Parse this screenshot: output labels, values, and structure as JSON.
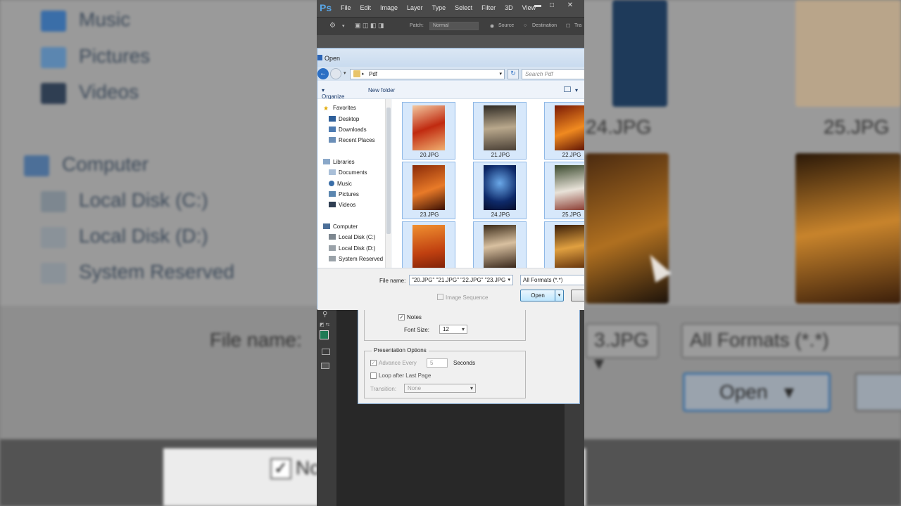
{
  "background": {
    "nav": [
      "Music",
      "Pictures",
      "Videos",
      "Computer",
      "Local Disk (C:)",
      "Local Disk (D:)",
      "System Reserved"
    ],
    "files": [
      "24.JPG",
      "25.JPG"
    ],
    "filename_label": "File name:",
    "filename_tail": "3.JPG",
    "format": "All Formats (*.*)",
    "open": "Open",
    "notes": "No"
  },
  "photoshop": {
    "logo": "Ps",
    "menu": [
      "File",
      "Edit",
      "Image",
      "Layer",
      "Type",
      "Select",
      "Filter",
      "3D",
      "View"
    ],
    "options": {
      "patch_label": "Patch:",
      "patch_mode": "Normal",
      "source": "Source",
      "destination": "Destination",
      "transparent": "Tra"
    }
  },
  "pdf_dialog": {
    "notes_label": "Notes",
    "font_size_label": "Font Size:",
    "font_size": "12",
    "presentation_title": "Presentation Options",
    "advance_label": "Advance Every",
    "advance_value": "5",
    "seconds_label": "Seconds",
    "loop_label": "Loop after Last Page",
    "transition_label": "Transition:",
    "transition": "None"
  },
  "open_dialog": {
    "title": "Open",
    "path": "Pdf",
    "search_placeholder": "Search Pdf",
    "organize": "Organize",
    "new_folder": "New folder",
    "nav": [
      "Favorites",
      "Desktop",
      "Downloads",
      "Recent Places",
      "Libraries",
      "Documents",
      "Music",
      "Pictures",
      "Videos",
      "Computer",
      "Local Disk (C:)",
      "Local Disk (D:)",
      "System Reserved"
    ],
    "files": [
      "20.JPG",
      "21.JPG",
      "22.JPG",
      "23.JPG",
      "24.JPG",
      "25.JPG"
    ],
    "file_name_label": "File name:",
    "file_name_value": "\"20.JPG\" \"21.JPG\" \"22.JPG\" \"23.JPG",
    "format": "All Formats (*.*)",
    "image_sequence": "Image Sequence",
    "open_button": "Open"
  }
}
